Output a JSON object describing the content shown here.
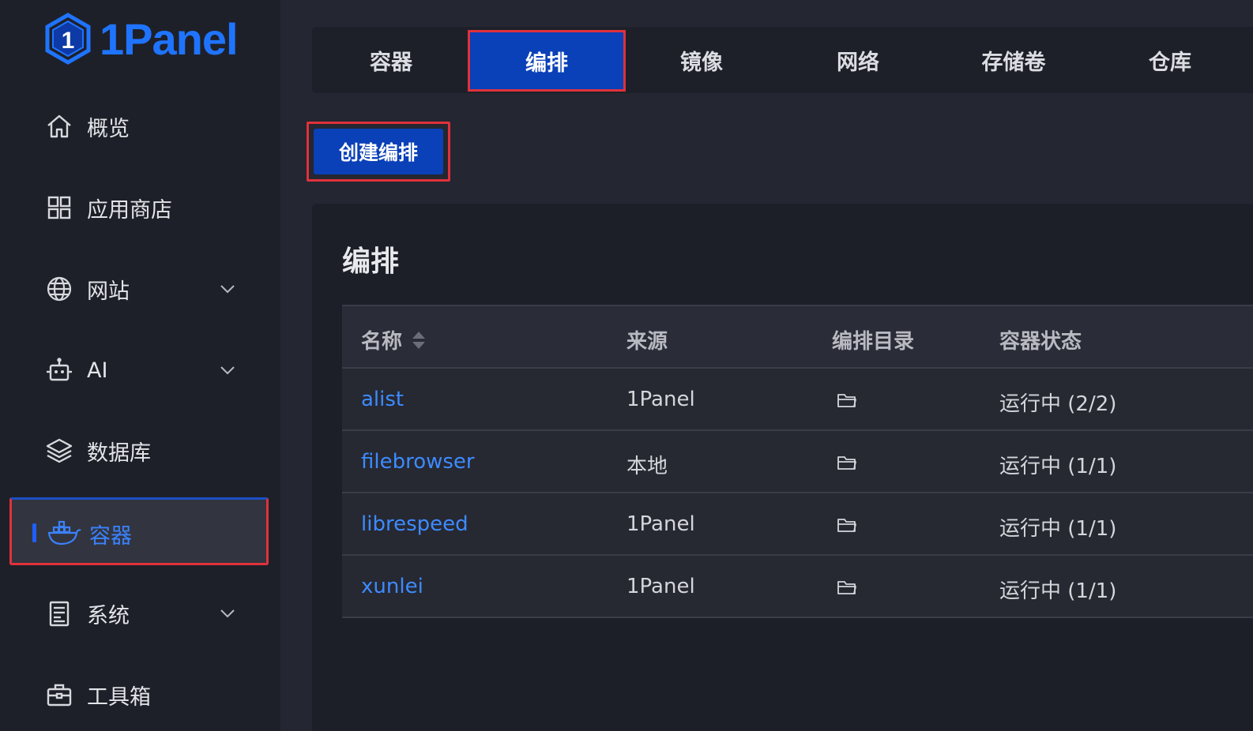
{
  "app": {
    "logo_text": "1Panel"
  },
  "sidebar": {
    "items": [
      {
        "label": "概览",
        "icon": "home-icon",
        "expandable": false
      },
      {
        "label": "应用商店",
        "icon": "apps-grid-icon",
        "expandable": false
      },
      {
        "label": "网站",
        "icon": "globe-icon",
        "expandable": true
      },
      {
        "label": "AI",
        "icon": "robot-icon",
        "expandable": true
      },
      {
        "label": "数据库",
        "icon": "layers-icon",
        "expandable": false
      },
      {
        "label": "容器",
        "icon": "docker-whale-icon",
        "expandable": false,
        "active": true
      },
      {
        "label": "系统",
        "icon": "document-icon",
        "expandable": true
      },
      {
        "label": "工具箱",
        "icon": "toolbox-icon",
        "expandable": false
      }
    ]
  },
  "tabs": [
    {
      "label": "容器"
    },
    {
      "label": "编排",
      "active": true
    },
    {
      "label": "镜像"
    },
    {
      "label": "网络"
    },
    {
      "label": "存储卷"
    },
    {
      "label": "仓库"
    }
  ],
  "toolbar": {
    "create_label": "创建编排"
  },
  "card": {
    "title": "编排"
  },
  "table": {
    "headers": {
      "name": "名称",
      "source": "来源",
      "dir": "编排目录",
      "status": "容器状态"
    },
    "rows": [
      {
        "name": "alist",
        "source": "1Panel",
        "status": "运行中 (2/2)"
      },
      {
        "name": "filebrowser",
        "source": "本地",
        "status": "运行中 (1/1)"
      },
      {
        "name": "librespeed",
        "source": "1Panel",
        "status": "运行中 (1/1)"
      },
      {
        "name": "xunlei",
        "source": "1Panel",
        "status": "运行中 (1/1)"
      }
    ]
  },
  "colors": {
    "accent": "#0a40b8",
    "link": "#3d8bff",
    "highlight_border": "#e0313b",
    "sidebar_bg": "#1e2029",
    "page_bg": "#242631"
  }
}
